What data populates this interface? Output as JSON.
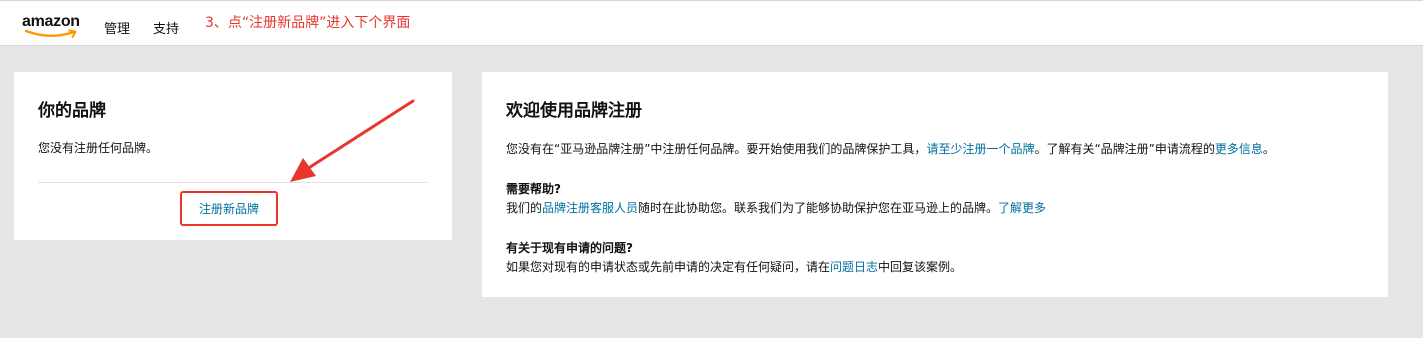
{
  "header": {
    "logo_text": "amazon",
    "nav": {
      "manage": "管理",
      "support": "支持"
    },
    "annotation": "3、点“注册新品牌”进入下个界面"
  },
  "left_card": {
    "title": "你的品牌",
    "empty_text": "您没有注册任何品牌。",
    "register_button": "注册新品牌"
  },
  "right_card": {
    "title": "欢迎使用品牌注册",
    "intro": {
      "text_1": "您没有在“亚马逊品牌注册”中注册任何品牌。要开始使用我们的品牌保护工具，",
      "link_1": "请至少注册一个品牌",
      "text_2": "。了解有关“品牌注册”申请流程的",
      "link_2": "更多信息",
      "text_3": "。"
    },
    "help": {
      "title": "需要帮助?",
      "text_1": "我们的",
      "link_1": "品牌注册客服人员",
      "text_2": "随时在此协助您。联系我们为了能够协助保护您在亚马逊上的品牌。",
      "link_2": "了解更多"
    },
    "issues": {
      "title": "有关于现有申请的问题?",
      "text_1": "如果您对现有的申请状态或先前申请的决定有任何疑问，请在",
      "link_1": "问题日志",
      "text_2": "中回复该案例。"
    }
  },
  "colors": {
    "annotation_red": "#e8362d",
    "link_blue": "#00709e",
    "page_background": "#e6e6e6",
    "logo_smile": "#ff9900"
  }
}
